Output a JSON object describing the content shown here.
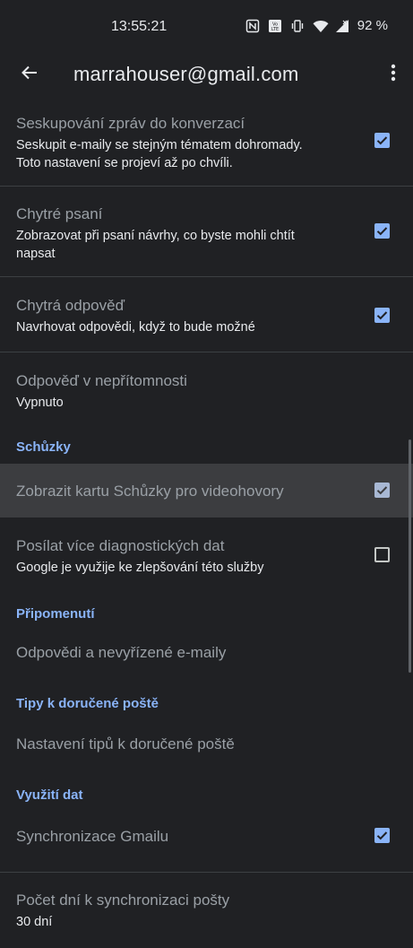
{
  "status_bar": {
    "time": "13:55:21",
    "battery": "92 %",
    "icons": [
      "nfc-icon",
      "volte-icon",
      "vibrate-icon",
      "wifi-icon",
      "signal-icon"
    ]
  },
  "appbar": {
    "title": "marrahouser@gmail.com",
    "back_icon": "arrow-back-icon",
    "more_icon": "more-vert-icon"
  },
  "settings": {
    "conversation": {
      "title": "Seskupování zpráv do konverzací",
      "summary_1": "Seskupit e-maily se stejným tématem dohromady.",
      "summary_2": "Toto nastavení se projeví až po chvíli.",
      "checked": true
    },
    "smart_compose": {
      "title": "Chytré psaní",
      "summary_1": "Zobrazovat při psaní návrhy, co byste mohli chtít",
      "summary_2": "napsat",
      "checked": true
    },
    "smart_reply": {
      "title": "Chytrá odpověď",
      "summary_1": "Navrhovat odpovědi, když to bude možné",
      "checked": true
    },
    "vacation": {
      "title": "Odpověď v nepřítomnosti",
      "summary_1": "Vypnuto"
    },
    "meet_header": "Schůzky",
    "meet_tab": {
      "title": "Zobrazit kartu Schůzky pro videohovory",
      "checked": true
    },
    "diagnostics": {
      "title": "Posílat více diagnostických dat",
      "summary_1": "Google je využije ke zlepšování této služby",
      "checked": false
    },
    "reminders_header": "Připomenutí",
    "reminders": {
      "title": "Odpovědi a nevyřízené e-maily"
    },
    "inbox_tips_header": "Tipy k doručené poště",
    "inbox_tips": {
      "title": "Nastavení tipů k doručené poště"
    },
    "data_usage_header": "Využití dat",
    "sync_gmail": {
      "title": "Synchronizace Gmailu",
      "checked": true
    },
    "sync_days": {
      "title": "Počet dní k synchronizaci pošty",
      "summary_1": "30 dní"
    }
  },
  "colors": {
    "background": "#202124",
    "accent": "#8ab4f8",
    "divider": "#3c4043",
    "highlight": "#3c3d40"
  }
}
